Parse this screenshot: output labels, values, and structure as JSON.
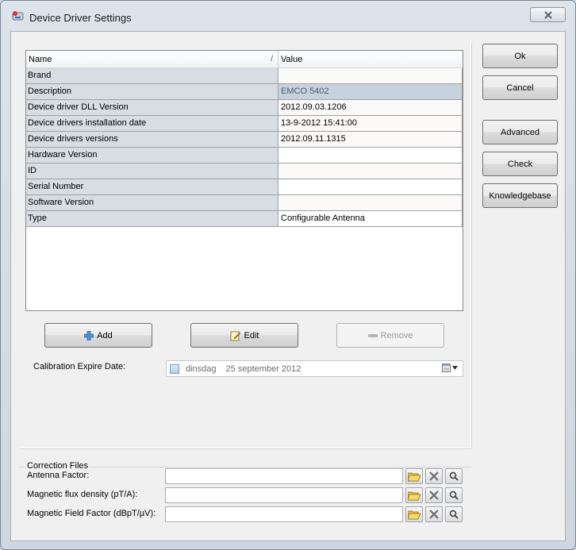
{
  "window": {
    "title": "Device Driver Settings"
  },
  "grid": {
    "columns": {
      "name": "Name",
      "value": "Value"
    },
    "rows": [
      {
        "name": "Brand",
        "value": ""
      },
      {
        "name": "Description",
        "value": "EMCO 5402"
      },
      {
        "name": "Device driver DLL Version",
        "value": "2012.09.03.1206"
      },
      {
        "name": "Device drivers installation date",
        "value": "13-9-2012 15:41:00"
      },
      {
        "name": "Device drivers versions",
        "value": "2012.09.11.1315"
      },
      {
        "name": "Hardware Version",
        "value": ""
      },
      {
        "name": "ID",
        "value": ""
      },
      {
        "name": "Serial Number",
        "value": ""
      },
      {
        "name": "Software Version",
        "value": ""
      },
      {
        "name": "Type",
        "value": "Configurable Antenna"
      }
    ]
  },
  "actions": {
    "add": "Add",
    "edit": "Edit",
    "remove": "Remove"
  },
  "calibration": {
    "label": "Calibration Expire Date:",
    "day": "dinsdag",
    "date": "25 september 2012"
  },
  "side_buttons": {
    "ok": "Ok",
    "cancel": "Cancel",
    "advanced": "Advanced",
    "check": "Check",
    "knowledgebase": "Knowledgebase"
  },
  "correction_files": {
    "title": "Correction Files",
    "rows": [
      {
        "label": "Antenna Factor:",
        "value": ""
      },
      {
        "label": "Magnetic flux density (pT/A):",
        "value": ""
      },
      {
        "label": "Magnetic Field Factor (dBpT/µV):",
        "value": ""
      }
    ]
  }
}
